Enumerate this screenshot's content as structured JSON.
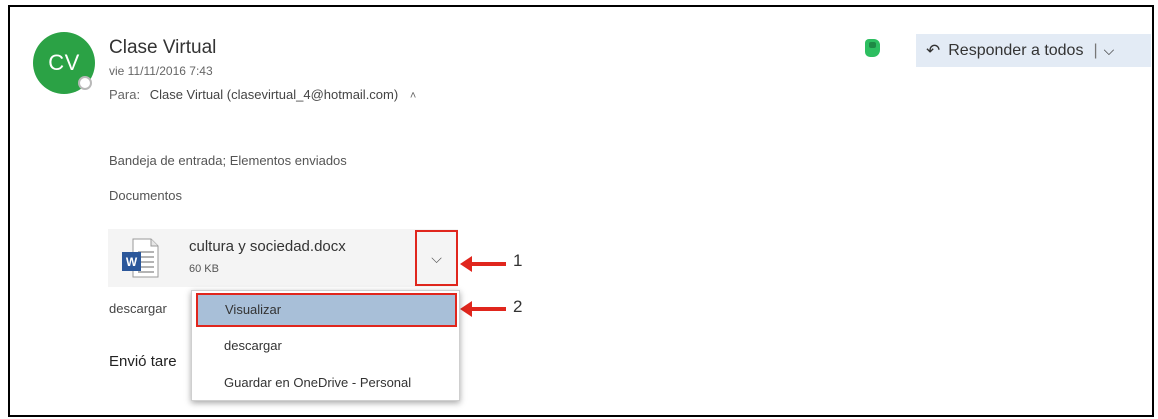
{
  "message": {
    "avatar_initials": "CV",
    "sender": "Clase Virtual",
    "date": "vie 11/11/2016 7:43",
    "to_label": "Para:",
    "to_value": "Clase Virtual (clasevirtual_4@hotmail.com)",
    "folders": "Bandeja de entrada; Elementos enviados",
    "category": "Documentos",
    "body_download": "descargar",
    "body_text": "Envió tare"
  },
  "toolbar": {
    "reply_all_label": "Responder a todos",
    "separator": "|"
  },
  "attachment": {
    "name": "cultura y sociedad.docx",
    "size": "60 KB"
  },
  "dropdown": {
    "items": [
      "Visualizar",
      "descargar",
      "Guardar en OneDrive - Personal"
    ]
  },
  "annotations": {
    "label_1": "1",
    "label_2": "2"
  },
  "icons": {
    "reply_all": "reply-all-icon",
    "chevron": "chevron-down-icon",
    "evernote": "evernote-icon",
    "word": "word-document-icon"
  },
  "colors": {
    "avatar_green": "#2ba245",
    "highlight_red": "#e0261d",
    "selected_item": "#a8bfd8",
    "reply_button_bg": "#e3ebf5"
  }
}
